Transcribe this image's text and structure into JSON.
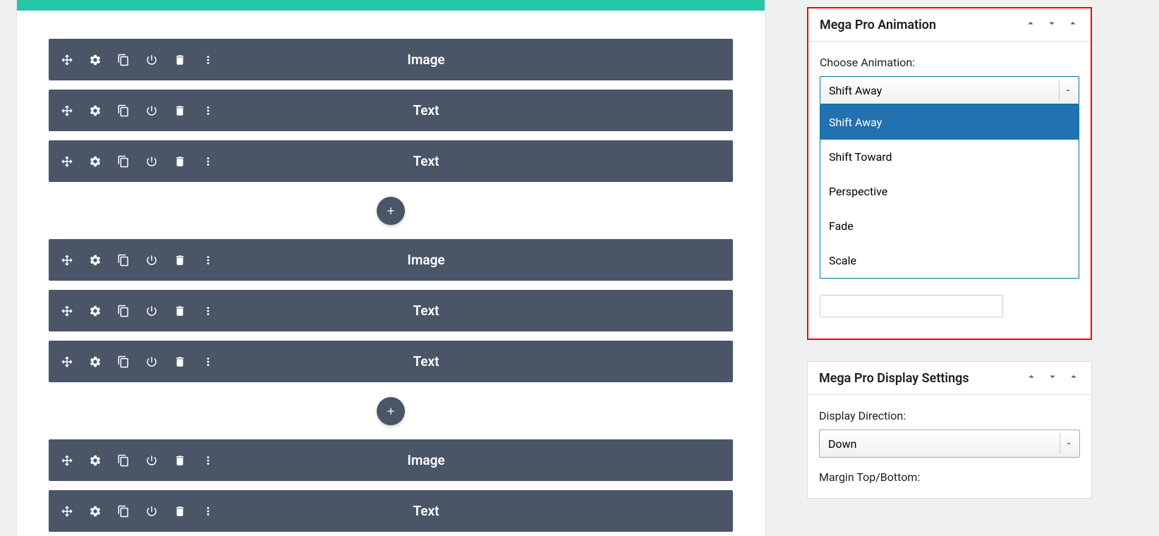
{
  "editor": {
    "groups": [
      {
        "items": [
          {
            "label": "Image"
          },
          {
            "label": "Text"
          },
          {
            "label": "Text"
          }
        ]
      },
      {
        "items": [
          {
            "label": "Image"
          },
          {
            "label": "Text"
          },
          {
            "label": "Text"
          }
        ]
      },
      {
        "items": [
          {
            "label": "Image"
          },
          {
            "label": "Text"
          }
        ]
      }
    ]
  },
  "sidebar": {
    "animation_panel": {
      "title": "Mega Pro Animation",
      "field_label": "Choose Animation:",
      "selected": "Shift Away",
      "options": [
        {
          "label": "Shift Away",
          "selected": true
        },
        {
          "label": "Shift Toward",
          "selected": false
        },
        {
          "label": "Perspective",
          "selected": false
        },
        {
          "label": "Fade",
          "selected": false
        },
        {
          "label": "Scale",
          "selected": false
        }
      ]
    },
    "display_panel": {
      "title": "Mega Pro Display Settings",
      "direction_label": "Display Direction:",
      "direction_value": "Down",
      "margin_label": "Margin Top/Bottom:"
    }
  }
}
